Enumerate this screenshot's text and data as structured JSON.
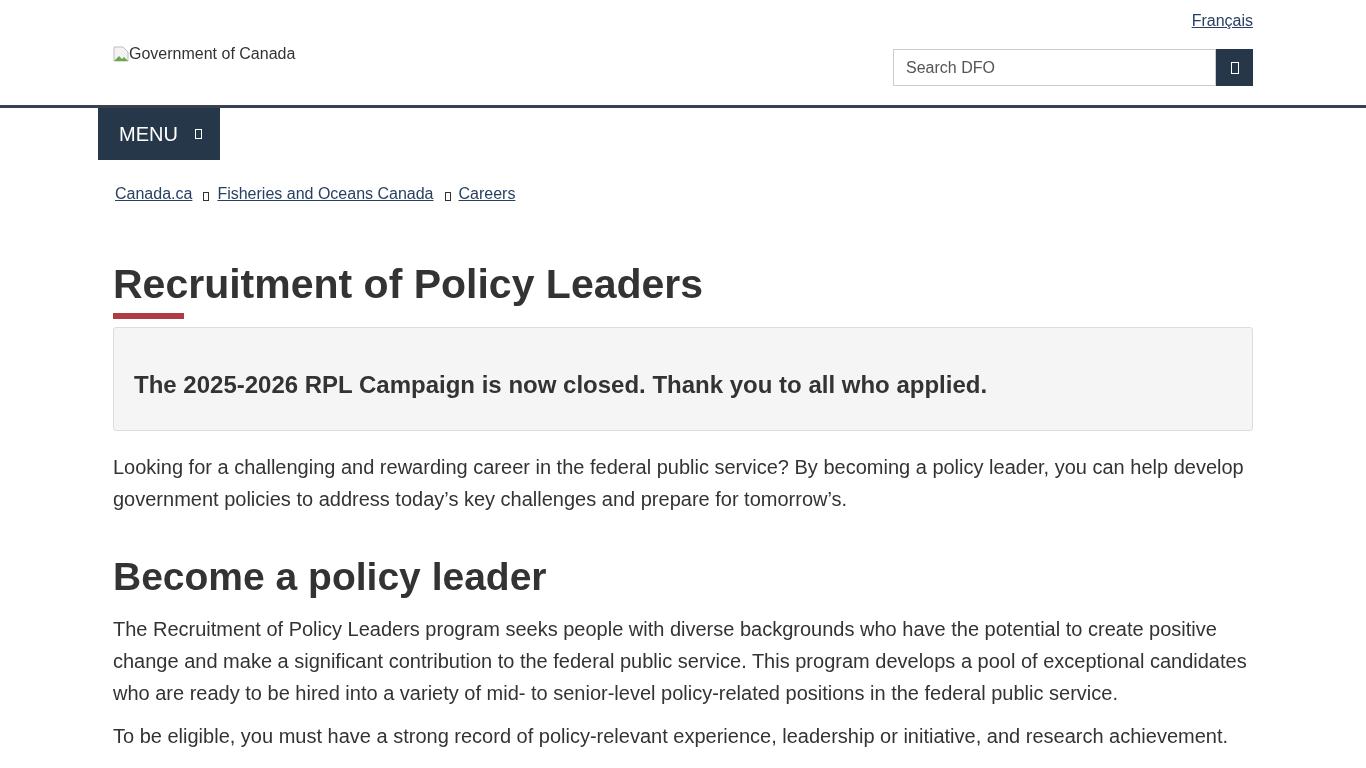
{
  "header": {
    "language_link": "Français",
    "logo_alt": "Government of Canada",
    "search": {
      "placeholder": "Search DFO"
    }
  },
  "menu_button": {
    "label": "MENU"
  },
  "breadcrumb": [
    "Canada.ca",
    "Fisheries and Oceans Canada",
    "Careers"
  ],
  "page_title": "Recruitment of Policy Leaders",
  "alert": {
    "text": "The 2025-2026 RPL Campaign is now closed. Thank you to all who applied."
  },
  "intro": "Looking for a challenging and rewarding career in the federal public service? By becoming a policy leader, you can help develop government policies to address today’s key challenges and prepare for tomorrow’s.",
  "sections": [
    {
      "heading": "Become a policy leader",
      "paragraphs": [
        "The Recruitment of Policy Leaders program seeks people with diverse backgrounds who have the potential to create positive change and make a significant contribution to the federal public service. This program develops a pool of exceptional candidates who are ready to be hired into a variety of mid- to senior-level policy-related positions in the federal public service.",
        "To be eligible, you must have a strong record of policy-relevant experience, leadership or initiative, and research achievement."
      ]
    }
  ]
}
